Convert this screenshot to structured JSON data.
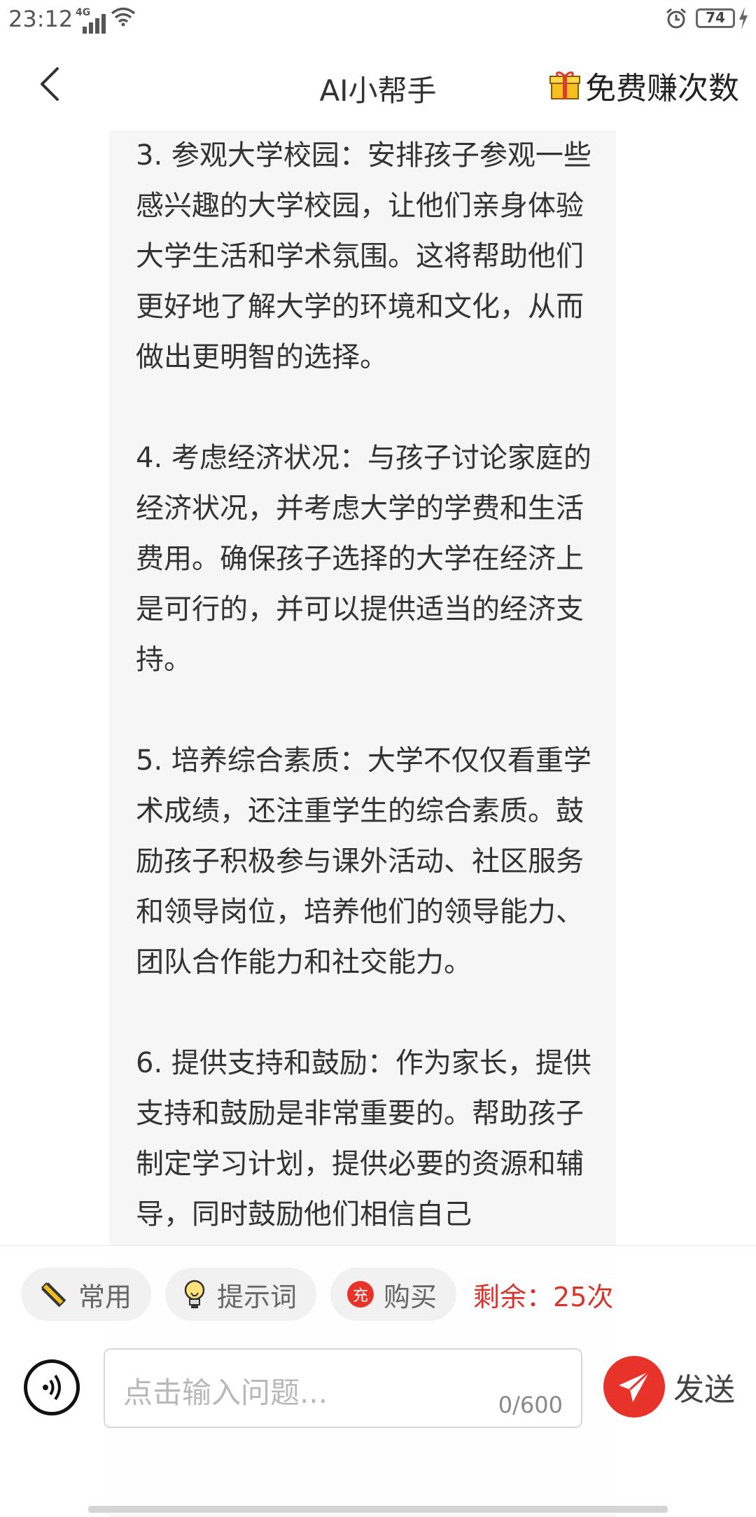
{
  "status_bar": {
    "time": "23:12",
    "network": "4G",
    "battery": "74"
  },
  "header": {
    "title": "AI小帮手",
    "earn_label": "免费赚次数"
  },
  "message": {
    "paragraphs": [
      "3. 参观大学校园：安排孩子参观一些感兴趣的大学校园，让他们亲身体验大学生活和学术氛围。这将帮助他们更好地了解大学的环境和文化，从而做出更明智的选择。",
      "4. 考虑经济状况：与孩子讨论家庭的经济状况，并考虑大学的学费和生活费用。确保孩子选择的大学在经济上是可行的，并可以提供适当的经济支持。",
      "5. 培养综合素质：大学不仅仅看重学术成绩，还注重学生的综合素质。鼓励孩子积极参与课外活动、社区服务和领导岗位，培养他们的领导能力、团队合作能力和社交能力。",
      "6. 提供支持和鼓励：作为家长，提供支持和鼓励是非常重要的。帮助孩子制定学习计划，提供必要的资源和辅导，同时鼓励他们相信自己"
    ]
  },
  "toolbar": {
    "common_label": "常用",
    "prompt_label": "提示词",
    "buy_badge": "充",
    "buy_label": "购买",
    "remaining": "剩余：25次"
  },
  "composer": {
    "placeholder": "点击输入问题...",
    "counter": "0/600",
    "send_label": "发送"
  },
  "colors": {
    "accent": "#e8332a",
    "chat_bg": "#f6f6f6"
  }
}
